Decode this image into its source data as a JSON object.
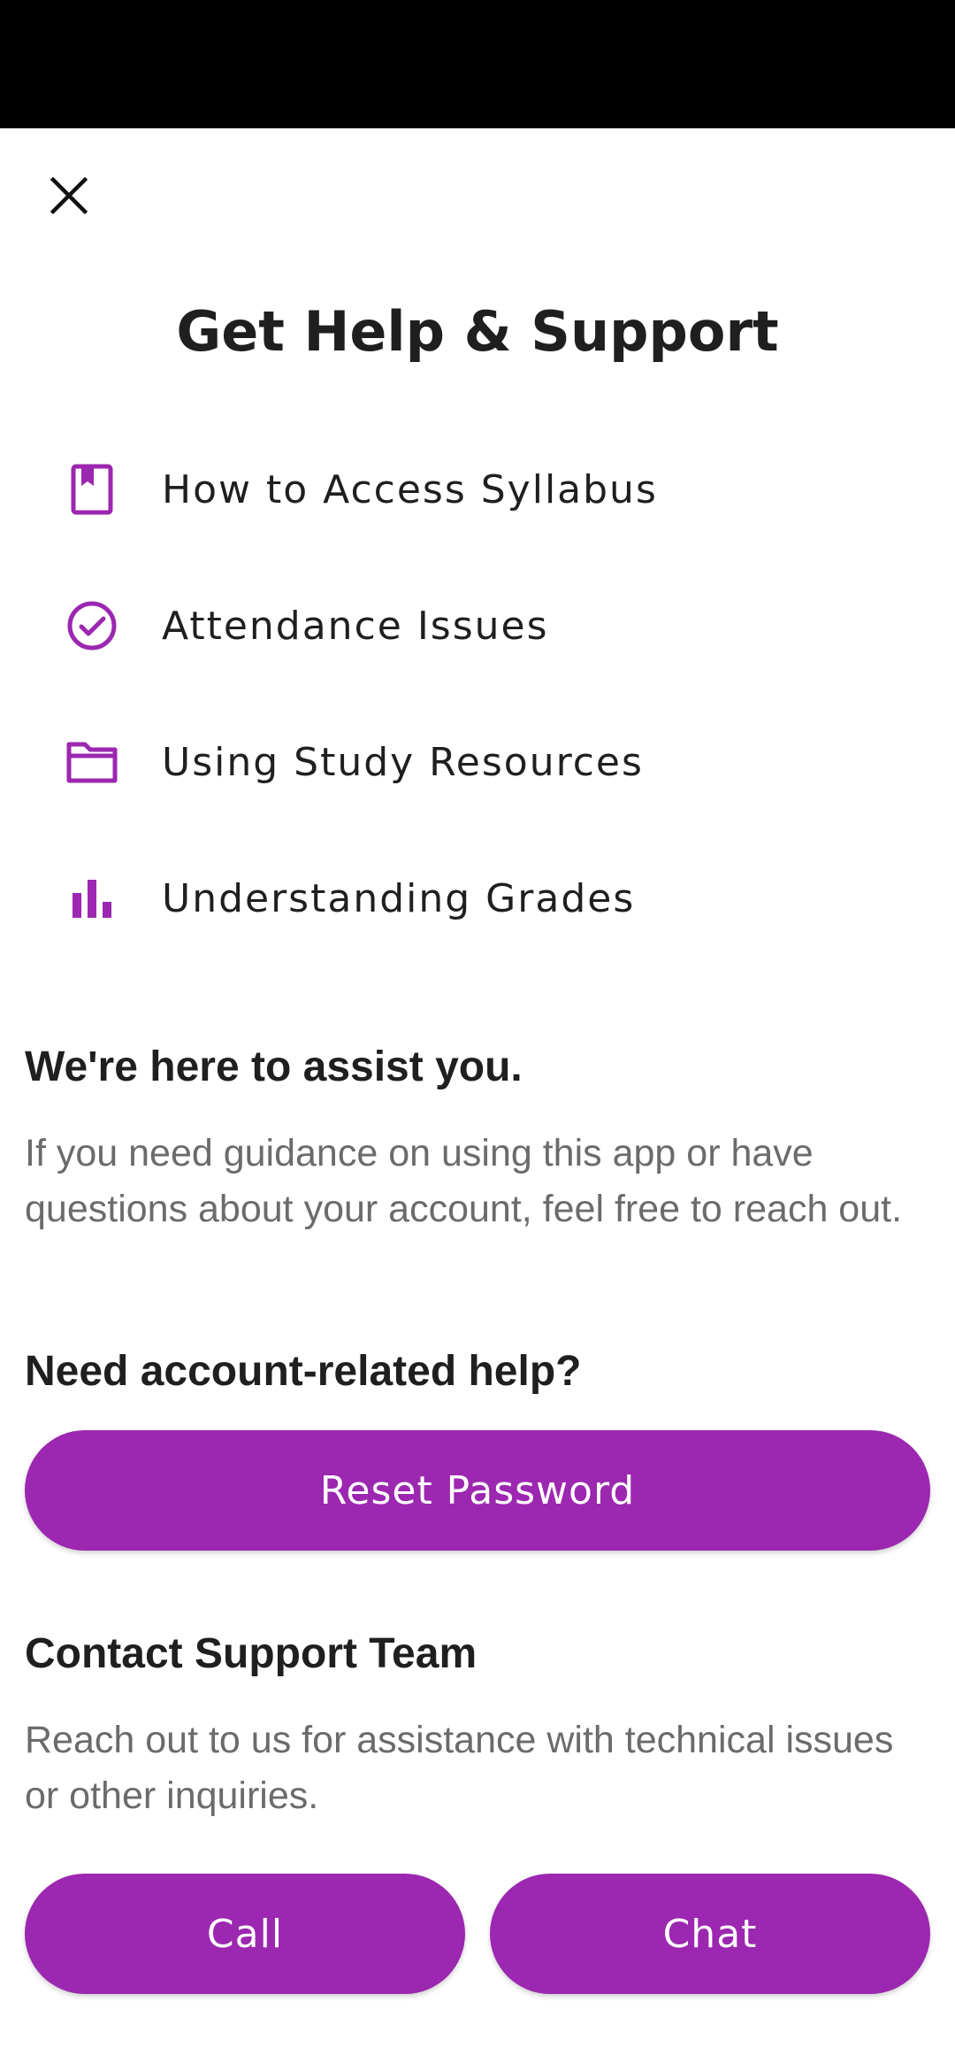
{
  "colors": {
    "accent": "#9c27b0",
    "status_bar": "#000000",
    "heading_text": "#1f1f1f",
    "body_text": "#6b6b6b"
  },
  "header": {
    "close_icon": "close-icon",
    "title": "Get Help & Support"
  },
  "help_items": [
    {
      "label": "How to Access Syllabus",
      "icon": "bookmark-book-icon"
    },
    {
      "label": "Attendance Issues",
      "icon": "check-circle-icon"
    },
    {
      "label": "Using Study Resources",
      "icon": "folder-icon"
    },
    {
      "label": "Understanding Grades",
      "icon": "bar-chart-icon"
    }
  ],
  "assist": {
    "heading": "We're here to assist you.",
    "body": "If you need guidance on using this app or have questions about your account, feel free to reach out."
  },
  "account": {
    "heading": "Need account-related help?",
    "reset_label": "Reset Password"
  },
  "contact": {
    "heading": "Contact Support Team",
    "body": "Reach out to us for assistance with technical issues or other inquiries.",
    "call_label": "Call",
    "chat_label": "Chat"
  }
}
